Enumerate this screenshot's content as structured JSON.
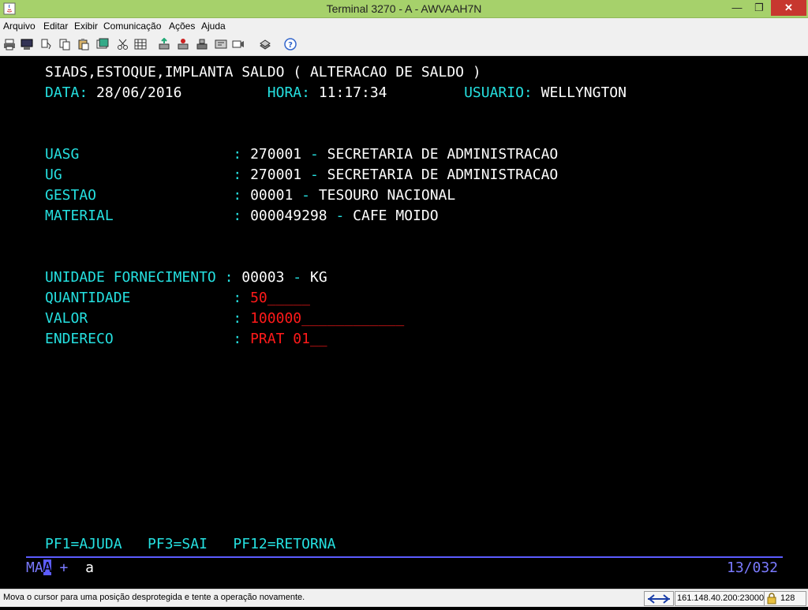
{
  "window": {
    "title": "Terminal 3270 - A - AWVAAH7N"
  },
  "menu": [
    {
      "label": "Arquivo"
    },
    {
      "label": "Editar"
    },
    {
      "label": "Exibir"
    },
    {
      "label": "Comunicação"
    },
    {
      "label": "Ações"
    },
    {
      "label": "Ajuda"
    }
  ],
  "toolbar_icons": [
    "print-icon",
    "print-screen-icon",
    "copy-icon",
    "paste-icon",
    "paste-append-icon",
    "clear-icon",
    "keypad-icon",
    "transfer-send-icon",
    "transfer-receive-icon",
    "pf-key-icon",
    "macro-icon",
    "settings-icon",
    "help-icon"
  ],
  "screen": {
    "line1": "SIADS,ESTOQUE,IMPLANTA SALDO ( ALTERACAO DE SALDO )",
    "data_label": "DATA:",
    "data_value": "28/06/2016",
    "hora_label": "HORA:",
    "hora_value": "11:17:34",
    "usuario_label": "USUARIO:",
    "usuario_value": "WELLYNGTON",
    "fields": {
      "uasg_label": "UASG                  :",
      "uasg_code": "270001",
      "uasg_name": "SECRETARIA DE ADMINISTRACAO",
      "ug_label": "UG                    :",
      "ug_code": "270001",
      "ug_name": "SECRETARIA DE ADMINISTRACAO",
      "gestao_label": "GESTAO                :",
      "gestao_code": "00001",
      "gestao_name": "TESOURO NACIONAL",
      "material_label": "MATERIAL              :",
      "material_code": "000049298",
      "material_name": "CAFE MOIDO",
      "unidade_label": "UNIDADE FORNECIMENTO :",
      "unidade_code": "00003",
      "unidade_name": "KG",
      "quantidade_label": "QUANTIDADE            :",
      "quantidade_value": "50_____",
      "valor_label": "VALOR                 :",
      "valor_value": "100000____________",
      "endereco_label": "ENDERECO              :",
      "endereco_value": "PRAT 01__",
      "separator": "-"
    },
    "pf_keys": "PF1=AJUDA   PF3=SAI   PF12=RETORNA"
  },
  "oia": {
    "left": "MA",
    "cursor": "A",
    "plus": "+",
    "a": "a",
    "position": "13/032"
  },
  "statusbar": {
    "message": "Mova o cursor para uma posição desprotegida e tente a operação novamente.",
    "host": "161.148.40.200:23000",
    "count": "128"
  },
  "colors": {
    "cyan": "#25e0e0",
    "white": "#ffffff",
    "red": "#ff1a1a",
    "oia": "#5c5cff",
    "titlebar": "#a6d16b"
  }
}
